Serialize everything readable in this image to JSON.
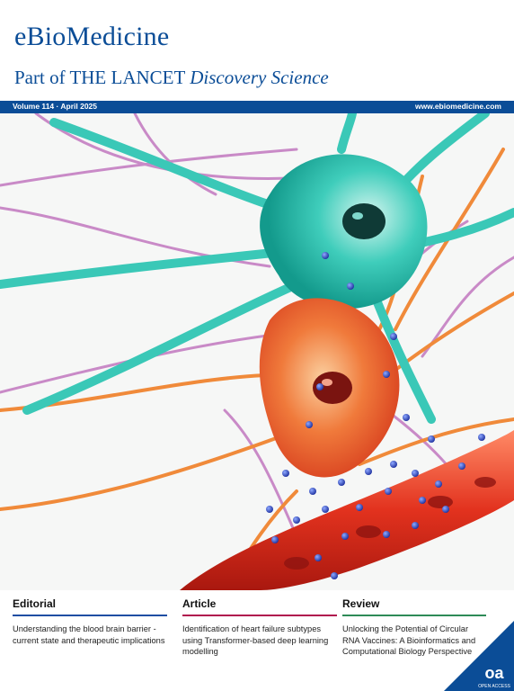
{
  "journal": {
    "title": "eBioMedicine",
    "subtitle_prefix": "Part of THE LANCET",
    "subtitle_suffix": "Discovery Science"
  },
  "bar": {
    "volume": "Volume 114 · April 2025",
    "url": "www.ebiomedicine.com"
  },
  "sections": [
    {
      "heading": "Editorial",
      "text": "Understanding the blood brain barrier - current state and therapeutic implications",
      "color": "#1f4ea3"
    },
    {
      "heading": "Article",
      "text": "Identification of heart failure subtypes using Transformer-based deep learning modelling",
      "color": "#b0124e"
    },
    {
      "heading": "Review",
      "text": "Unlocking the Potential of Circular RNA Vaccines: A Bioinformatics and Computational Biology Perspective",
      "color": "#2e8b57"
    }
  ],
  "badge": {
    "big": "oa",
    "small": "OPEN ACCESS"
  },
  "colors": {
    "brand": "#0b4d97",
    "neuron": "#2ec4b6",
    "cell": "#e8542a",
    "vessel": "#c9261b",
    "purple": "#c77bc3",
    "orange": "#f07a2b"
  }
}
